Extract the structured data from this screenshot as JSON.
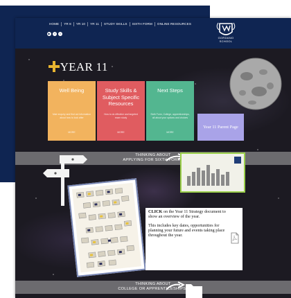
{
  "nav": [
    "HOME",
    "YR 8",
    "YR 10",
    "YR 11",
    "STUDY SKILLS",
    "SIXTH FORM",
    "ONLINE RESOURCES"
  ],
  "school": {
    "name_line1": "GORDANO",
    "name_line2": "SCHOOL"
  },
  "page_title": "YEAR 11",
  "tiles": [
    {
      "title": "Well Being",
      "text": "Mair enquiry and find out information about how to look after",
      "more": "MORE",
      "color": "#f2b35e"
    },
    {
      "title": "Study Skills & Subject Specific Resources",
      "text": "How to do effective and targeted exam study",
      "more": "MORE",
      "color": "#e05c60"
    },
    {
      "title": "Next Steps",
      "text": "Sixth Form, College, apprenticeships, all about your options and choices",
      "more": "MORE",
      "color": "#53b690"
    }
  ],
  "parent_page": "Year 11 Parent Page",
  "band1": {
    "line1": "THINKING ABOUT",
    "line2": "APPLYING FOR SIXTH FORM?"
  },
  "band2": {
    "line1": "THINKING ABOUT",
    "line2": "COLLEGE OR APPRENTICESHIPS?"
  },
  "info": {
    "p1_bold": "CLICK",
    "p1_rest": " on the Year 11 Strategy document to show an overview of the year.",
    "p2": "This includes key dates, opportunities for planning your future and events taking place throughout the year."
  },
  "colors": {
    "navy": "#0f2552",
    "gold": "#e8b530",
    "green_border": "#9bd04a"
  }
}
